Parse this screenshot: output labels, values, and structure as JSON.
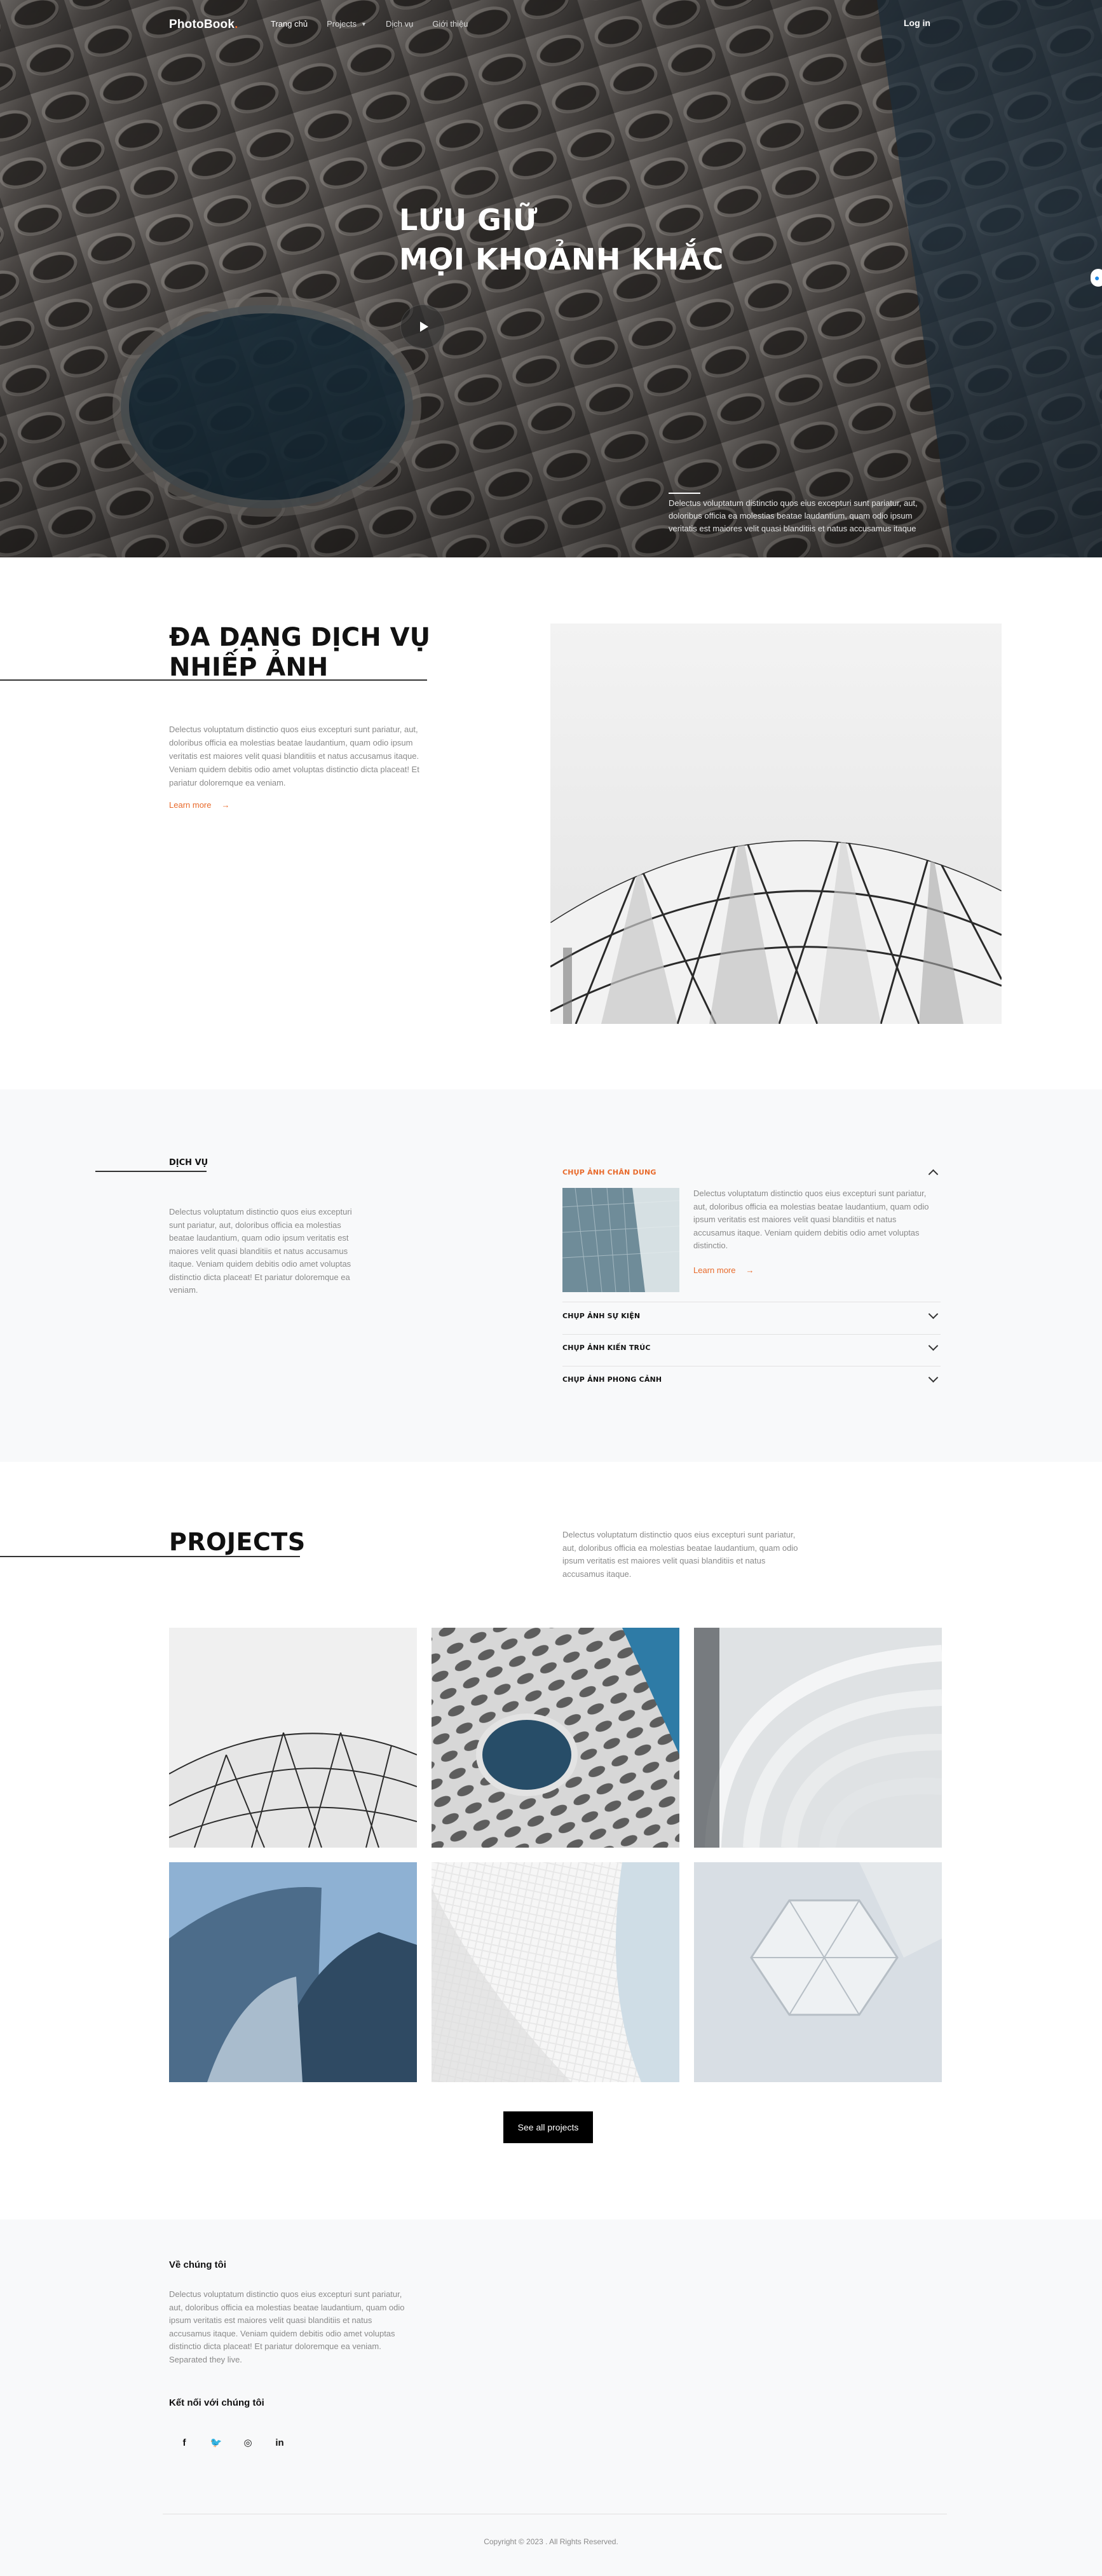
{
  "nav": {
    "logo": "PhotoBook",
    "logo_dot": ".",
    "items": [
      {
        "label": "Trang chủ"
      },
      {
        "label": "Projects"
      },
      {
        "label": "Dịch vụ"
      },
      {
        "label": "Giới thiệu"
      }
    ],
    "login": "Log in"
  },
  "hero": {
    "title_line1": "LƯU GIỮ",
    "title_line2": "MỌI KHOẢNH KHẮC",
    "caption": "Delectus voluptatum distinctio quos eius excepturi sunt pariatur, aut, doloribus officia ea molestias beatae laudantium, quam odio ipsum veritatis est maiores velit quasi blanditiis et natus accusamus itaque"
  },
  "services_intro": {
    "title_line1": "ĐA DẠNG DỊCH VỤ",
    "title_line2": "NHIẾP ẢNH",
    "text": "Delectus voluptatum distinctio quos eius excepturi sunt pariatur, aut, doloribus officia ea molestias beatae laudantium, quam odio ipsum veritatis est maiores velit quasi blanditiis et natus accusamus itaque. Veniam quidem debitis odio amet voluptas distinctio dicta placeat! Et pariatur doloremque ea veniam.",
    "learn_more": "Learn more"
  },
  "dich_vu": {
    "label": "DỊCH VỤ",
    "text": "Delectus voluptatum distinctio quos eius excepturi sunt pariatur, aut, doloribus officia ea molestias beatae laudantium, quam odio ipsum veritatis est maiores velit quasi blanditiis et natus accusamus itaque. Veniam quidem debitis odio amet voluptas distinctio dicta placeat! Et pariatur doloremque ea veniam.",
    "accordion": [
      {
        "title": "CHỤP ẢNH CHÂN DUNG",
        "open": true
      },
      {
        "title": "CHỤP ẢNH SỰ KIỆN",
        "open": false
      },
      {
        "title": "CHỤP ẢNH KIẾN TRÚC",
        "open": false
      },
      {
        "title": "CHỤP ẢNH PHONG CẢNH",
        "open": false
      }
    ],
    "open_text": "Delectus voluptatum distinctio quos eius excepturi sunt pariatur, aut, doloribus officia ea molestias beatae laudantium, quam odio ipsum veritatis est maiores velit quasi blanditiis et natus accusamus itaque. Veniam quidem debitis odio amet voluptas distinctio.",
    "learn_more": "Learn more"
  },
  "projects": {
    "title": "PROJECTS",
    "text": "Delectus voluptatum distinctio quos eius excepturi sunt pariatur, aut, doloribus officia ea molestias beatae laudantium, quam odio ipsum veritatis est maiores velit quasi blanditiis et natus accusamus itaque.",
    "see_all": "See all projects"
  },
  "footer": {
    "about_title": "Về chúng tôi",
    "about_text": "Delectus voluptatum distinctio quos eius excepturi sunt pariatur, aut, doloribus officia ea molestias beatae laudantium, quam odio ipsum veritatis est maiores velit quasi blanditiis et natus accusamus itaque. Veniam quidem debitis odio amet voluptas distinctio dicta placeat! Et pariatur doloremque ea veniam. Separated they live.",
    "connect_title": "Kết nối với chúng tôi",
    "social": [
      {
        "glyph": "f"
      },
      {
        "glyph": "🐦"
      },
      {
        "glyph": "◎"
      },
      {
        "glyph": "in"
      }
    ],
    "copyright": "Copyright © 2023 . All Rights Reserved."
  },
  "colors": {
    "accent": "#e86a2b",
    "dark": "#111111",
    "muted": "#8a8a8a",
    "section_bg": "#f8f9fa"
  },
  "icons": [
    "play-icon",
    "chevron-up-icon",
    "chevron-down-icon",
    "arrow-right-icon",
    "facebook-icon",
    "twitter-icon",
    "instagram-icon",
    "linkedin-icon",
    "chevron-down-icon"
  ]
}
